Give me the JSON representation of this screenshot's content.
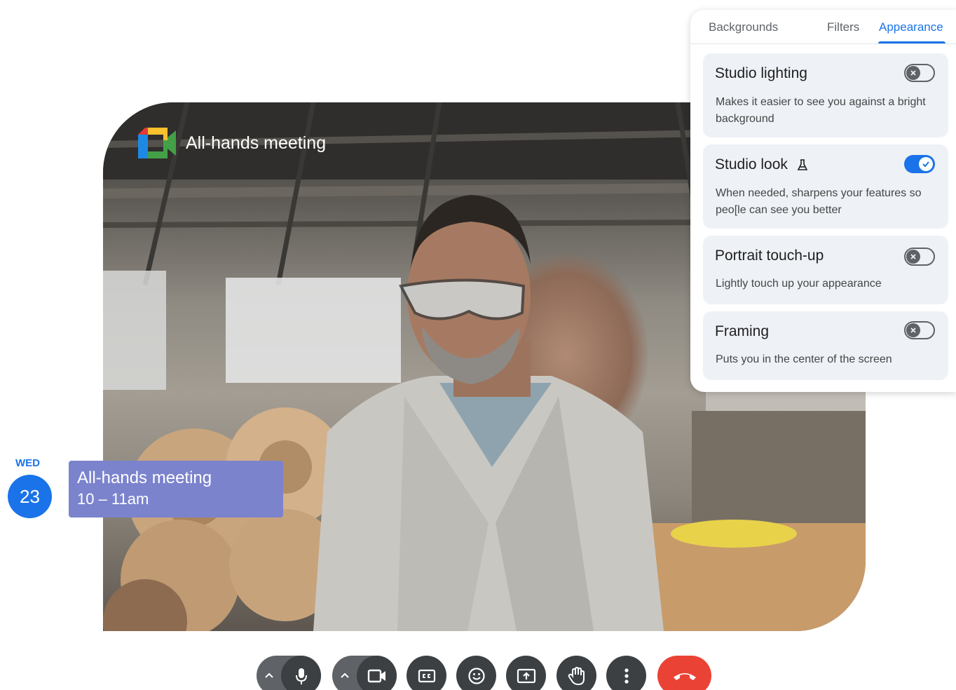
{
  "meeting": {
    "title": "All-hands meeting"
  },
  "panel": {
    "tabs": [
      {
        "label": "Backgrounds",
        "active": false
      },
      {
        "label": "Filters",
        "active": false
      },
      {
        "label": "Appearance",
        "active": true
      }
    ],
    "cards": [
      {
        "title": "Studio lighting",
        "description": "Makes it easier to see you against a bright background",
        "enabled": false,
        "icon": ""
      },
      {
        "title": "Studio look",
        "description": "When needed, sharpens your features so peo[le can see you better",
        "enabled": true,
        "icon": "flask-icon"
      },
      {
        "title": "Portrait touch-up",
        "description": "Lightly touch up your appearance",
        "enabled": false,
        "icon": ""
      },
      {
        "title": "Framing",
        "description": "Puts you in the center of the screen",
        "enabled": false,
        "icon": ""
      }
    ]
  },
  "calendar": {
    "weekday": "WED",
    "day": "23",
    "event_title": "All-hands meeting",
    "event_time": "10 – 11am",
    "event_color": "#7b83cd"
  },
  "controls": [
    {
      "name": "microphone-button",
      "icon": "mic-icon",
      "has_options": true
    },
    {
      "name": "camera-button",
      "icon": "video-camera-icon",
      "has_options": true
    },
    {
      "name": "captions-button",
      "icon": "closed-captions-icon"
    },
    {
      "name": "reactions-button",
      "icon": "emoji-icon"
    },
    {
      "name": "present-button",
      "icon": "present-screen-icon"
    },
    {
      "name": "raise-hand-button",
      "icon": "raise-hand-icon"
    },
    {
      "name": "more-options-button",
      "icon": "more-vert-icon"
    },
    {
      "name": "leave-call-button",
      "icon": "end-call-icon",
      "color": "#ea4335"
    }
  ],
  "colors": {
    "accent": "#1a73e8",
    "control_dark": "#3c4043",
    "end_call": "#ea4335"
  }
}
